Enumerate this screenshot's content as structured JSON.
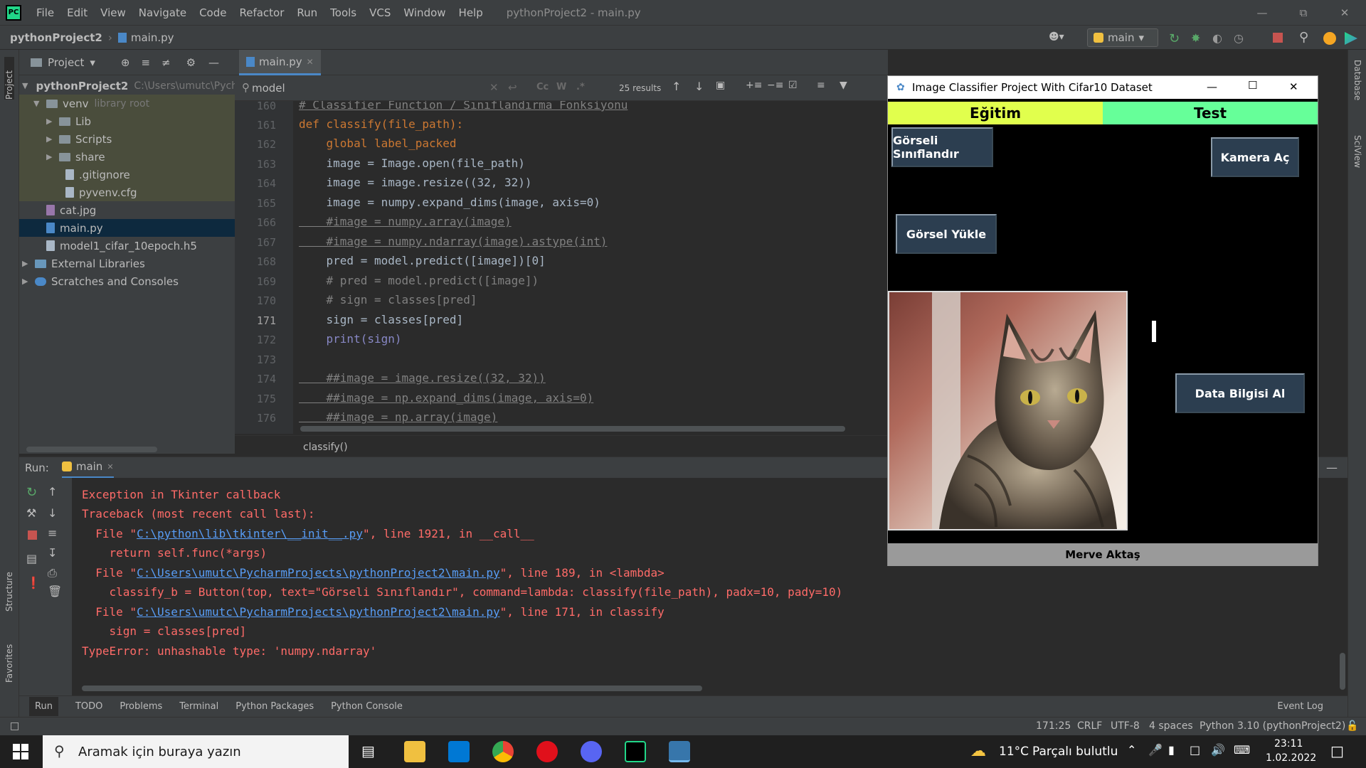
{
  "titlebar": {
    "menu": [
      "File",
      "Edit",
      "View",
      "Navigate",
      "Code",
      "Refactor",
      "Run",
      "Tools",
      "VCS",
      "Window",
      "Help"
    ],
    "window_title": "pythonProject2 - main.py"
  },
  "navbar": {
    "project": "pythonProject2",
    "file": "main.py",
    "run_config": "main"
  },
  "project_panel": {
    "header": "Project",
    "items": [
      {
        "label": "pythonProject2",
        "hint": "C:\\Users\\umutc\\Pychar"
      },
      {
        "label": "venv",
        "hint": "library root"
      },
      {
        "label": "Lib"
      },
      {
        "label": "Scripts"
      },
      {
        "label": "share"
      },
      {
        "label": ".gitignore"
      },
      {
        "label": "pyvenv.cfg"
      },
      {
        "label": "cat.jpg"
      },
      {
        "label": "main.py"
      },
      {
        "label": "model1_cifar_10epoch.h5"
      },
      {
        "label": "External Libraries"
      },
      {
        "label": "Scratches and Consoles"
      }
    ]
  },
  "editor": {
    "tab": "main.py",
    "search_query": "model",
    "search_results": "25 results",
    "breadcrumb": "classify()",
    "line_numbers": [
      "160",
      "161",
      "162",
      "163",
      "164",
      "165",
      "166",
      "167",
      "168",
      "169",
      "170",
      "171",
      "172",
      "173",
      "174",
      "175",
      "176"
    ],
    "lines": [
      "# Classifier Function / Sınıflandırma Fonksiyonu",
      "def classify(file_path):",
      "    global label_packed",
      "    image = Image.open(file_path)",
      "    image = image.resize((32, 32))",
      "    image = numpy.expand_dims(image, axis=0)",
      "    #image = numpy.array(image)",
      "    #image = numpy.ndarray(image).astype(int)",
      "    pred = model.predict([image])[0]",
      "    # pred = model.predict([image])",
      "    # sign = classes[pred]",
      "    sign = classes[pred]",
      "    print(sign)",
      "",
      "    ##image = image.resize((32, 32))",
      "    ##image = np.expand_dims(image, axis=0)",
      "    ##image = np.array(image)"
    ]
  },
  "run_panel": {
    "label": "Run:",
    "tab": "main",
    "console": {
      "l1": "Exception in Tkinter callback",
      "l2": "Traceback (most recent call last):",
      "f1_pre": "  File \"",
      "f1_link": "C:\\python\\lib\\tkinter\\__init__.py",
      "f1_post": "\", line 1921, in __call__",
      "l4": "    return self.func(*args)",
      "f2_pre": "  File \"",
      "f2_link": "C:\\Users\\umutc\\PycharmProjects\\pythonProject2\\main.py",
      "f2_post": "\", line 189, in <lambda>",
      "l6": "    classify_b = Button(top, text=\"Görseli Sınıflandır\", command=lambda: classify(file_path), padx=10, pady=10)",
      "f3_pre": "  File \"",
      "f3_link": "C:\\Users\\umutc\\PycharmProjects\\pythonProject2\\main.py",
      "f3_post": "\", line 171, in classify",
      "l8": "    sign = classes[pred]",
      "l9": "TypeError: unhashable type: 'numpy.ndarray'"
    }
  },
  "bottom_tabs": [
    "Run",
    "TODO",
    "Problems",
    "Terminal",
    "Python Packages",
    "Python Console",
    "Event Log"
  ],
  "side_labels": {
    "project": "Project",
    "structure": "Structure",
    "favorites": "Favorites",
    "database": "Database",
    "sciview": "SciView"
  },
  "statusbar": {
    "position": "171:25",
    "line_sep": "CRLF",
    "encoding": "UTF-8",
    "indent": "4 spaces",
    "interpreter": "Python 3.10 (pythonProject2)"
  },
  "tk_window": {
    "title": "Image Classifier Project With Cifar10 Dataset",
    "tab_train": "Eğitim",
    "tab_test": "Test",
    "btn_classify": "Görseli Sınıflandır",
    "btn_camera": "Kamera Aç",
    "btn_upload": "Görsel Yükle",
    "btn_data": "Data Bilgisi Al",
    "footer": "Merve Aktaş",
    "colors": {
      "train_tab": "#e1ff4d",
      "test_tab": "#66ff99",
      "button": "#2c3e50"
    }
  },
  "taskbar": {
    "search_placeholder": "Aramak için buraya yazın",
    "weather_temp": "11°C",
    "weather_desc": "Parçalı bulutlu",
    "time": "23:11",
    "date": "1.02.2022"
  }
}
